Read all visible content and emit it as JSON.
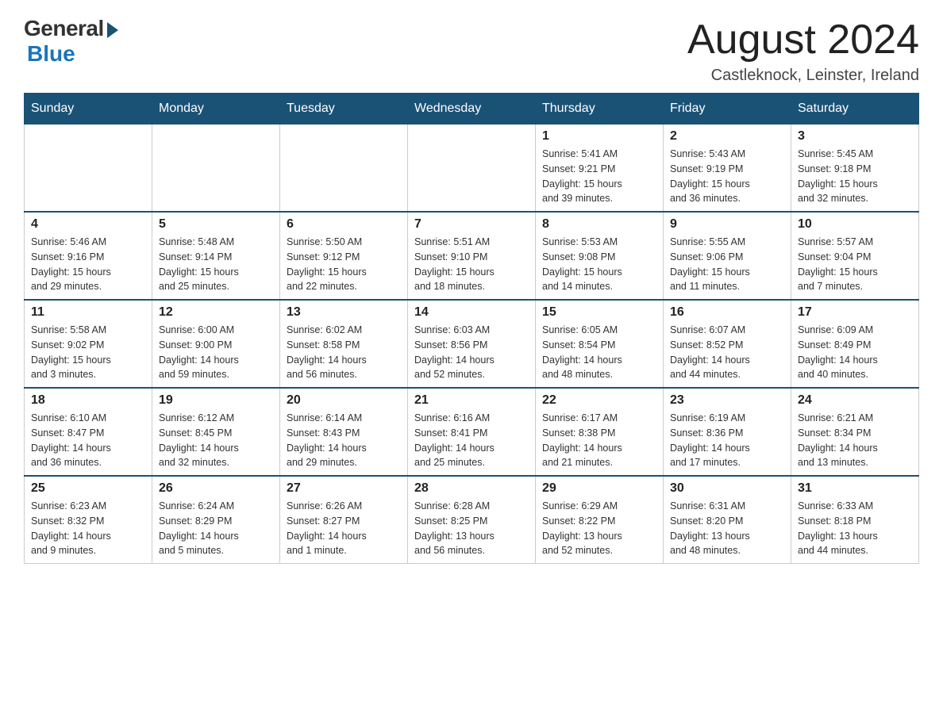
{
  "header": {
    "logo": {
      "general": "General",
      "blue": "Blue"
    },
    "title": "August 2024",
    "location": "Castleknock, Leinster, Ireland"
  },
  "days_of_week": [
    "Sunday",
    "Monday",
    "Tuesday",
    "Wednesday",
    "Thursday",
    "Friday",
    "Saturday"
  ],
  "weeks": [
    [
      {
        "day": "",
        "info": ""
      },
      {
        "day": "",
        "info": ""
      },
      {
        "day": "",
        "info": ""
      },
      {
        "day": "",
        "info": ""
      },
      {
        "day": "1",
        "info": "Sunrise: 5:41 AM\nSunset: 9:21 PM\nDaylight: 15 hours\nand 39 minutes."
      },
      {
        "day": "2",
        "info": "Sunrise: 5:43 AM\nSunset: 9:19 PM\nDaylight: 15 hours\nand 36 minutes."
      },
      {
        "day": "3",
        "info": "Sunrise: 5:45 AM\nSunset: 9:18 PM\nDaylight: 15 hours\nand 32 minutes."
      }
    ],
    [
      {
        "day": "4",
        "info": "Sunrise: 5:46 AM\nSunset: 9:16 PM\nDaylight: 15 hours\nand 29 minutes."
      },
      {
        "day": "5",
        "info": "Sunrise: 5:48 AM\nSunset: 9:14 PM\nDaylight: 15 hours\nand 25 minutes."
      },
      {
        "day": "6",
        "info": "Sunrise: 5:50 AM\nSunset: 9:12 PM\nDaylight: 15 hours\nand 22 minutes."
      },
      {
        "day": "7",
        "info": "Sunrise: 5:51 AM\nSunset: 9:10 PM\nDaylight: 15 hours\nand 18 minutes."
      },
      {
        "day": "8",
        "info": "Sunrise: 5:53 AM\nSunset: 9:08 PM\nDaylight: 15 hours\nand 14 minutes."
      },
      {
        "day": "9",
        "info": "Sunrise: 5:55 AM\nSunset: 9:06 PM\nDaylight: 15 hours\nand 11 minutes."
      },
      {
        "day": "10",
        "info": "Sunrise: 5:57 AM\nSunset: 9:04 PM\nDaylight: 15 hours\nand 7 minutes."
      }
    ],
    [
      {
        "day": "11",
        "info": "Sunrise: 5:58 AM\nSunset: 9:02 PM\nDaylight: 15 hours\nand 3 minutes."
      },
      {
        "day": "12",
        "info": "Sunrise: 6:00 AM\nSunset: 9:00 PM\nDaylight: 14 hours\nand 59 minutes."
      },
      {
        "day": "13",
        "info": "Sunrise: 6:02 AM\nSunset: 8:58 PM\nDaylight: 14 hours\nand 56 minutes."
      },
      {
        "day": "14",
        "info": "Sunrise: 6:03 AM\nSunset: 8:56 PM\nDaylight: 14 hours\nand 52 minutes."
      },
      {
        "day": "15",
        "info": "Sunrise: 6:05 AM\nSunset: 8:54 PM\nDaylight: 14 hours\nand 48 minutes."
      },
      {
        "day": "16",
        "info": "Sunrise: 6:07 AM\nSunset: 8:52 PM\nDaylight: 14 hours\nand 44 minutes."
      },
      {
        "day": "17",
        "info": "Sunrise: 6:09 AM\nSunset: 8:49 PM\nDaylight: 14 hours\nand 40 minutes."
      }
    ],
    [
      {
        "day": "18",
        "info": "Sunrise: 6:10 AM\nSunset: 8:47 PM\nDaylight: 14 hours\nand 36 minutes."
      },
      {
        "day": "19",
        "info": "Sunrise: 6:12 AM\nSunset: 8:45 PM\nDaylight: 14 hours\nand 32 minutes."
      },
      {
        "day": "20",
        "info": "Sunrise: 6:14 AM\nSunset: 8:43 PM\nDaylight: 14 hours\nand 29 minutes."
      },
      {
        "day": "21",
        "info": "Sunrise: 6:16 AM\nSunset: 8:41 PM\nDaylight: 14 hours\nand 25 minutes."
      },
      {
        "day": "22",
        "info": "Sunrise: 6:17 AM\nSunset: 8:38 PM\nDaylight: 14 hours\nand 21 minutes."
      },
      {
        "day": "23",
        "info": "Sunrise: 6:19 AM\nSunset: 8:36 PM\nDaylight: 14 hours\nand 17 minutes."
      },
      {
        "day": "24",
        "info": "Sunrise: 6:21 AM\nSunset: 8:34 PM\nDaylight: 14 hours\nand 13 minutes."
      }
    ],
    [
      {
        "day": "25",
        "info": "Sunrise: 6:23 AM\nSunset: 8:32 PM\nDaylight: 14 hours\nand 9 minutes."
      },
      {
        "day": "26",
        "info": "Sunrise: 6:24 AM\nSunset: 8:29 PM\nDaylight: 14 hours\nand 5 minutes."
      },
      {
        "day": "27",
        "info": "Sunrise: 6:26 AM\nSunset: 8:27 PM\nDaylight: 14 hours\nand 1 minute."
      },
      {
        "day": "28",
        "info": "Sunrise: 6:28 AM\nSunset: 8:25 PM\nDaylight: 13 hours\nand 56 minutes."
      },
      {
        "day": "29",
        "info": "Sunrise: 6:29 AM\nSunset: 8:22 PM\nDaylight: 13 hours\nand 52 minutes."
      },
      {
        "day": "30",
        "info": "Sunrise: 6:31 AM\nSunset: 8:20 PM\nDaylight: 13 hours\nand 48 minutes."
      },
      {
        "day": "31",
        "info": "Sunrise: 6:33 AM\nSunset: 8:18 PM\nDaylight: 13 hours\nand 44 minutes."
      }
    ]
  ]
}
